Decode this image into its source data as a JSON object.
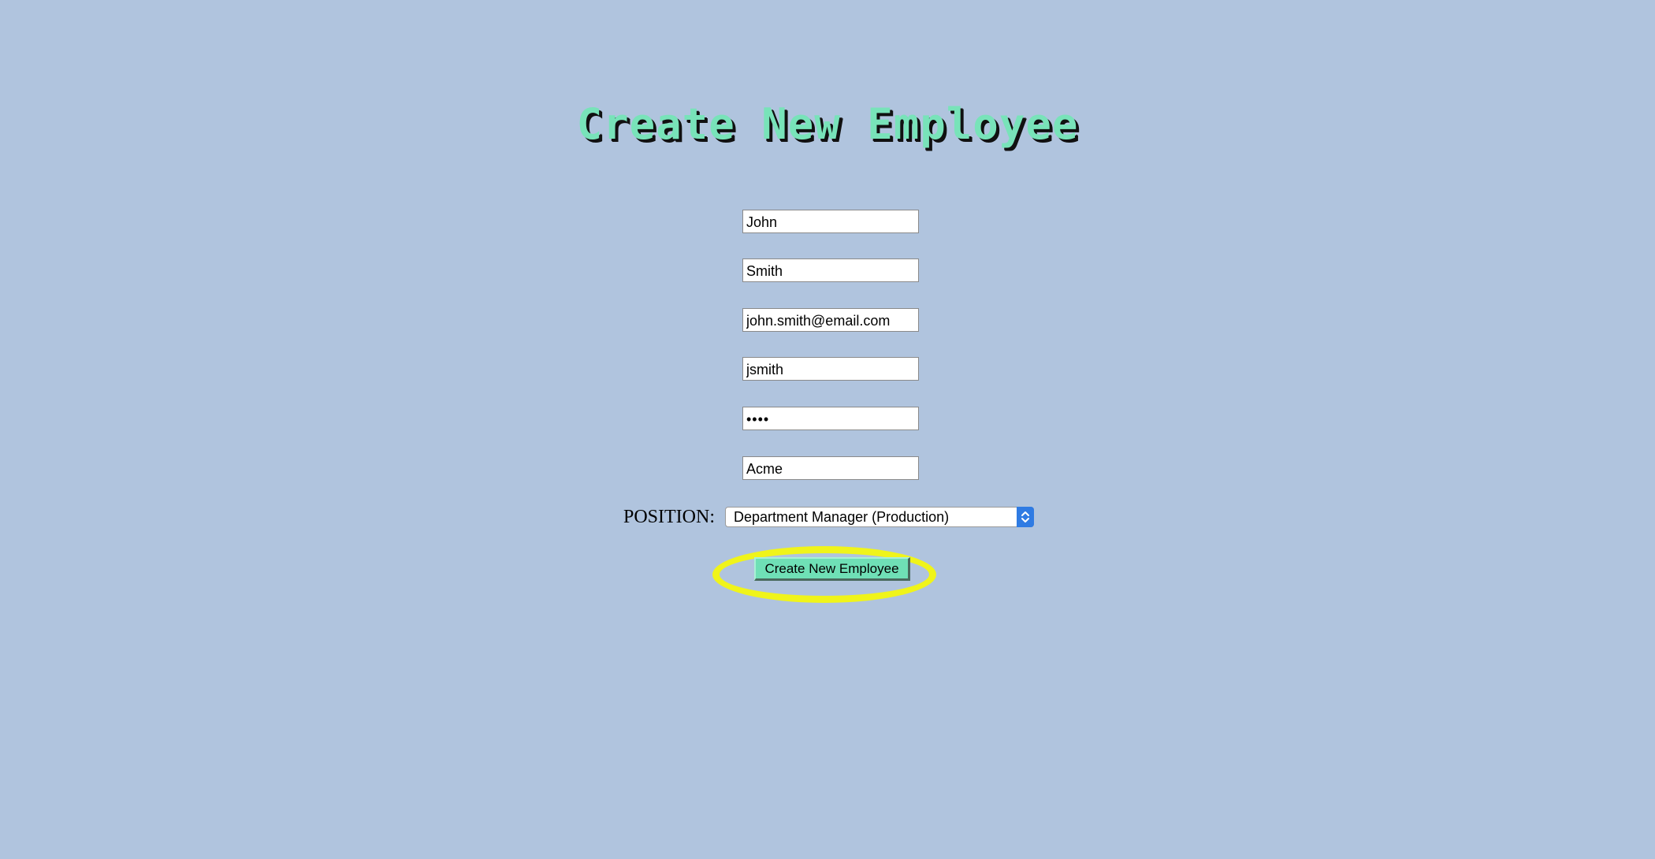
{
  "page": {
    "title": "Create New Employee",
    "background_color": "#b0c4de",
    "title_color": "#78e3b9"
  },
  "form": {
    "first_name": "John",
    "last_name": "Smith",
    "email": "john.smith@email.com",
    "username": "jsmith",
    "password_masked": "••••",
    "company": "Acme",
    "position_label": "POSITION:",
    "position_selected": "Department Manager (Production)",
    "submit_label": "Create New Employee",
    "submit_color": "#6fe0b6",
    "highlight_color": "#f0f41a",
    "select_arrow_icon": "chevron-up-down-icon"
  }
}
